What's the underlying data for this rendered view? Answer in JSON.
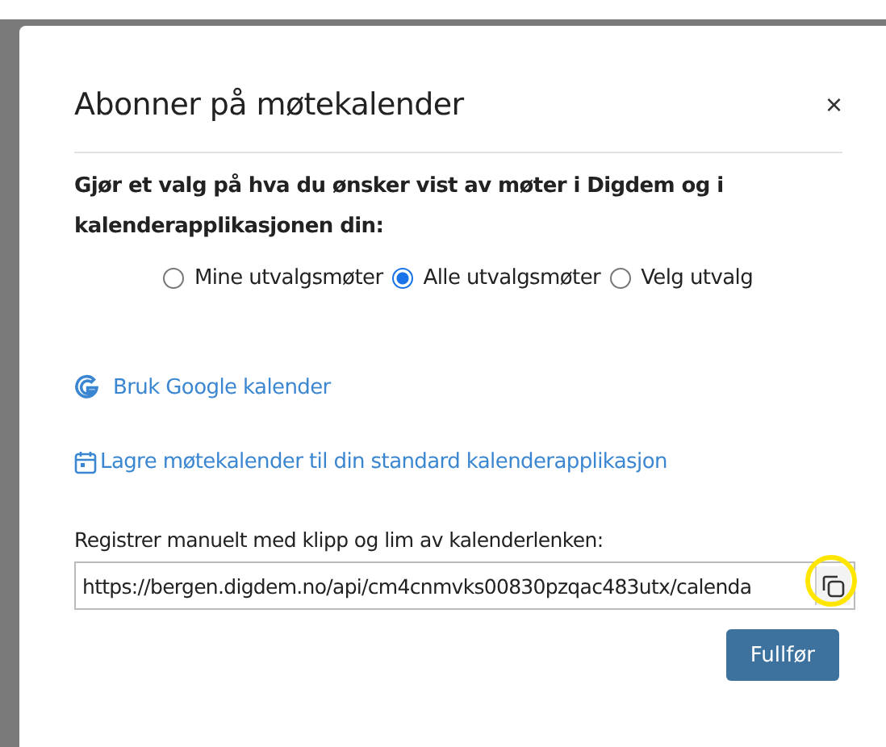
{
  "dialog": {
    "title": "Abonner på møtekalender",
    "close": "×",
    "intro": "Gjør et valg på hva du ønsker vist av møter i Digdem og i kalenderapplikasjonen din:",
    "options": [
      {
        "label": "Mine utvalgsmøter",
        "selected": false
      },
      {
        "label": "Alle utvalgsmøter",
        "selected": true
      },
      {
        "label": "Velg utvalg",
        "selected": false
      }
    ],
    "links": [
      {
        "kind": "google",
        "label": "Bruk Google kalender"
      },
      {
        "kind": "calendar",
        "label": "Lagre møtekalender til din standard kalenderapplikasjon"
      }
    ],
    "manual_label": "Registrer manuelt med klipp og lim av kalenderlenken:",
    "url": "https://bergen.digdem.no/api/cm4cnmvks00830pzqac483utx/calenda",
    "copy_highlighted": true,
    "button": "Fullfør"
  }
}
